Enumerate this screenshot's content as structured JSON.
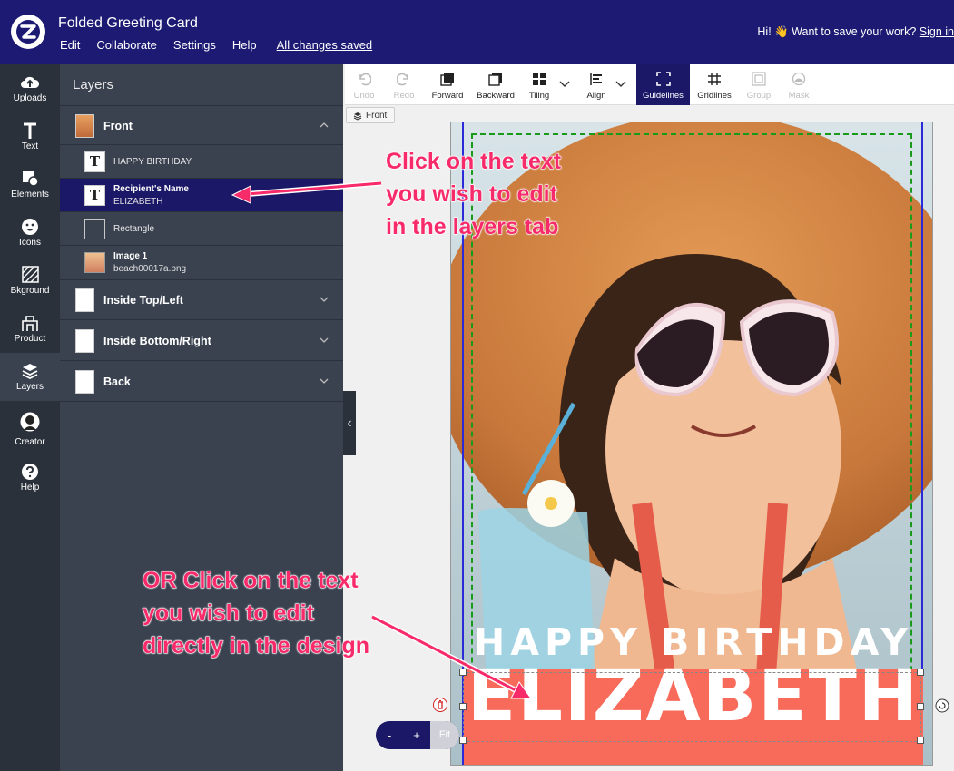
{
  "header": {
    "title": "Folded Greeting Card",
    "menu": [
      "Edit",
      "Collaborate",
      "Settings",
      "Help"
    ],
    "saved_status": "All changes saved",
    "greeting": "Hi! 👋 Want to save your work?",
    "signin_label": "Sign in"
  },
  "rail": {
    "items": [
      {
        "label": "Uploads",
        "icon": "cloud-upload-icon"
      },
      {
        "label": "Text",
        "icon": "text-icon"
      },
      {
        "label": "Elements",
        "icon": "elements-icon"
      },
      {
        "label": "Icons",
        "icon": "smiley-icon"
      },
      {
        "label": "Bkground",
        "icon": "background-icon"
      },
      {
        "label": "Product",
        "icon": "product-icon"
      },
      {
        "label": "Layers",
        "icon": "layers-icon"
      },
      {
        "label": "Creator",
        "icon": "creator-icon"
      },
      {
        "label": "Help",
        "icon": "help-icon"
      }
    ],
    "active": "Layers"
  },
  "layers_panel": {
    "title": "Layers",
    "groups": [
      {
        "name": "Front",
        "expanded": true
      },
      {
        "name": "Inside Top/Left",
        "expanded": false
      },
      {
        "name": "Inside Bottom/Right",
        "expanded": false
      },
      {
        "name": "Back",
        "expanded": false
      }
    ],
    "front_layers": [
      {
        "type": "T",
        "line1": "",
        "line2": "HAPPY BIRTHDAY"
      },
      {
        "type": "T",
        "line1": "Recipient's Name",
        "line2": "ELIZABETH",
        "selected": true
      },
      {
        "type": "rect",
        "line1": "",
        "line2": "Rectangle"
      },
      {
        "type": "image",
        "line1": "Image 1",
        "line2": "beach00017a.png"
      }
    ]
  },
  "toolbar": {
    "undo": "Undo",
    "redo": "Redo",
    "forward": "Forward",
    "backward": "Backward",
    "tiling": "Tiling",
    "align": "Align",
    "guidelines": "Guidelines",
    "gridlines": "Gridlines",
    "group": "Group",
    "mask": "Mask"
  },
  "canvas": {
    "side_chip": "Front",
    "headline": "HAPPY BIRTHDAY",
    "name": "ELIZABETH",
    "colors": {
      "name_band": "#f86a5a",
      "header_bg": "#1c1a73",
      "selected_layer": "#1a1867"
    }
  },
  "zoom": {
    "minus": "-",
    "plus": "+",
    "fit": "Fit"
  },
  "annotations": {
    "top": [
      "Click on the text",
      "you wish to edit",
      "in the layers tab"
    ],
    "bottom": [
      "OR Click on the text",
      "you wish to edit",
      "directly in the design"
    ]
  }
}
